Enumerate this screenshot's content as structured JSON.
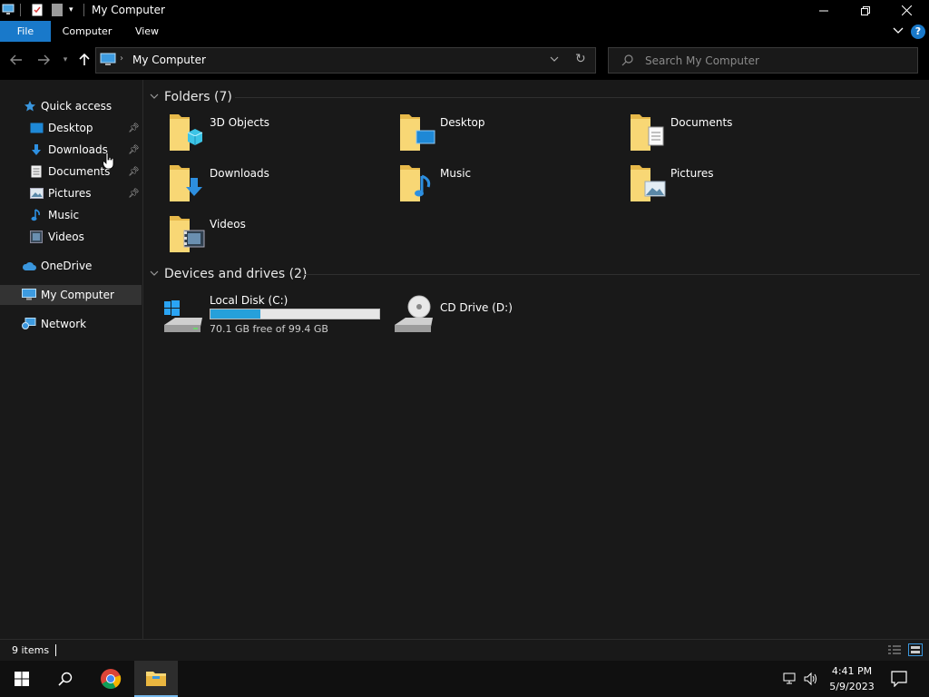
{
  "window": {
    "title": "My Computer",
    "minimize_icon": "minimize-icon",
    "restore_icon": "restore-icon",
    "close_icon": "close-icon"
  },
  "ribbon": {
    "tabs": [
      {
        "label": "File"
      },
      {
        "label": "Computer"
      },
      {
        "label": "View"
      }
    ]
  },
  "address": {
    "path": "My Computer",
    "search_placeholder": "Search My Computer"
  },
  "nav": {
    "quick_access": "Quick access",
    "items": [
      {
        "label": "Desktop",
        "pinned": true
      },
      {
        "label": "Downloads",
        "pinned": true
      },
      {
        "label": "Documents",
        "pinned": true
      },
      {
        "label": "Pictures",
        "pinned": true
      },
      {
        "label": "Music",
        "pinned": false
      },
      {
        "label": "Videos",
        "pinned": false
      }
    ],
    "onedrive": "OneDrive",
    "my_computer": "My Computer",
    "network": "Network"
  },
  "content": {
    "folders_header": "Folders (7)",
    "folders": [
      {
        "label": "3D Objects",
        "overlay": "cube"
      },
      {
        "label": "Desktop",
        "overlay": "desktop"
      },
      {
        "label": "Documents",
        "overlay": "document"
      },
      {
        "label": "Downloads",
        "overlay": "download"
      },
      {
        "label": "Music",
        "overlay": "music"
      },
      {
        "label": "Pictures",
        "overlay": "picture"
      },
      {
        "label": "Videos",
        "overlay": "video"
      }
    ],
    "drives_header": "Devices and drives (2)",
    "drives": [
      {
        "label": "Local Disk (C:)",
        "free_text": "70.1 GB free of 99.4 GB",
        "used_fraction": 0.295
      },
      {
        "label": "CD Drive (D:)"
      }
    ]
  },
  "status": {
    "items_count": "9 items"
  },
  "taskbar": {
    "time": "4:41 PM",
    "date": "5/9/2023"
  },
  "colors": {
    "accent": "#1979ca",
    "folder": "#f8d775",
    "drive_fill": "#26a0da"
  }
}
